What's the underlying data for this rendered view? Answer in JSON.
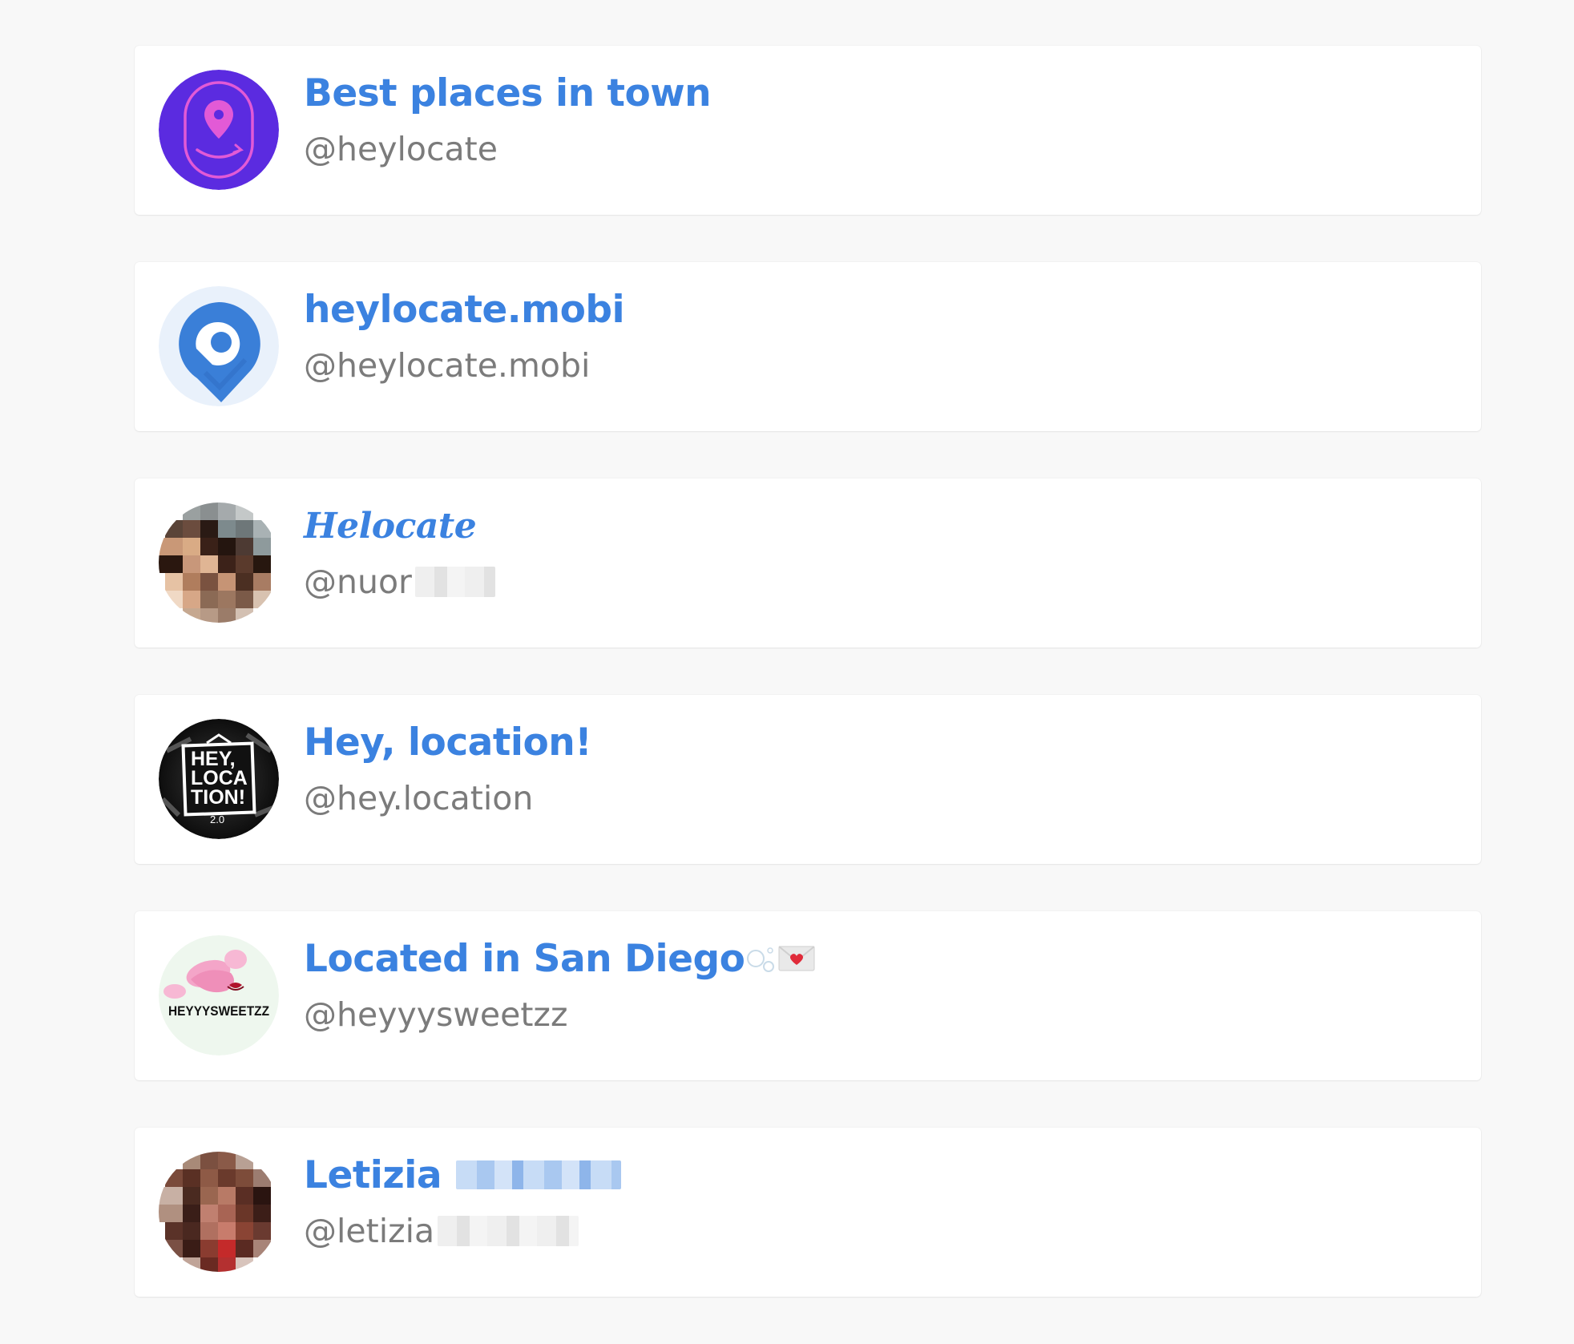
{
  "results": [
    {
      "name": "Best places in town",
      "handle": "@heylocate",
      "avatar": "purple-location-pin-logo"
    },
    {
      "name": "heylocate.mobi",
      "handle": "@heylocate.mobi",
      "avatar": "blue-location-pin-logo"
    },
    {
      "name": "Helocate",
      "handle": "@nuor",
      "avatar": "pixelated-photo"
    },
    {
      "name": "Hey, location!",
      "handle": "@hey.location",
      "avatar": "hey-location-logo",
      "avatar_text": [
        "HEY,",
        "LOCA",
        "TION!",
        "2.0"
      ]
    },
    {
      "name": "Located in San Diego",
      "handle": "@heyyysweetzz",
      "avatar": "candy-logo",
      "avatar_text": "HEYYYSWEETZZ",
      "name_emoji": [
        "bubbles-icon",
        "love-letter-icon"
      ]
    },
    {
      "name": "Letizia",
      "handle": "@letizia",
      "avatar": "pixelated-photo"
    }
  ],
  "colors": {
    "page_bg": "#f8f8f8",
    "card_bg": "#ffffff",
    "name": "#3b82e0",
    "handle": "#7b7b7b"
  }
}
